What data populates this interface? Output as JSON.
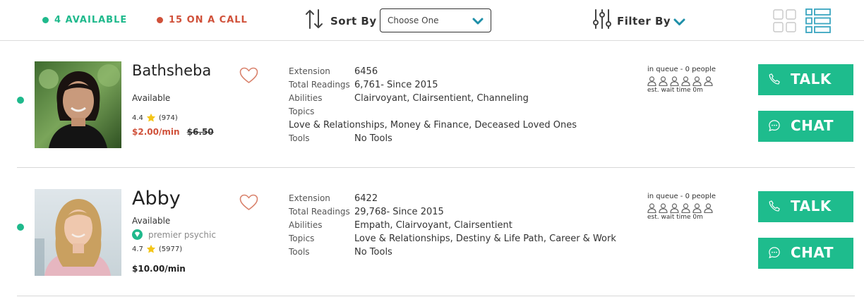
{
  "colors": {
    "accent": "#1fb98c",
    "oncall": "#d0513a",
    "button": "#1ebc8d"
  },
  "topbar": {
    "available_text": "4 AVAILABLE",
    "oncall_text": "15 ON A CALL",
    "sort_label": "Sort By",
    "sort_value": "Choose One",
    "filter_label": "Filter By",
    "icons": [
      "sort-arrows-icon",
      "chevron-down-icon",
      "filter-sliders-icon",
      "grid-view-icon",
      "list-view-icon"
    ]
  },
  "psychics": [
    {
      "name": "Bathsheba",
      "status": "Available",
      "rating": "4.4",
      "reviews": "(974)",
      "price": "$2.00/min",
      "old_price": "$6.50",
      "details": {
        "extension_label": "Extension",
        "extension": "6456",
        "readings_label": "Total Readings",
        "readings": "6,761- Since 2015",
        "abilities_label": "Abilities",
        "abilities": "Clairvoyant, Clairsentient, Channeling",
        "topics_label": "Topics",
        "topics": "Love & Relationships, Money & Finance, Deceased Loved Ones",
        "tools_label": "Tools",
        "tools": "No Tools"
      },
      "queue": {
        "title": "in queue - 0 people",
        "wait": "est. wait time 0m",
        "slots": 6
      },
      "talk_label": "TALK",
      "chat_label": "CHAT"
    },
    {
      "name": "Abby",
      "status": "Available",
      "badge": "premier psychic",
      "rating": "4.7",
      "reviews": "(5977)",
      "price": "$10.00/min",
      "details": {
        "extension_label": "Extension",
        "extension": "6422",
        "readings_label": "Total Readings",
        "readings": "29,768- Since 2015",
        "abilities_label": "Abilities",
        "abilities": "Empath, Clairvoyant, Clairsentient",
        "topics_label": "Topics",
        "topics": "Love & Relationships, Destiny & Life Path, Career & Work",
        "tools_label": "Tools",
        "tools": "No Tools"
      },
      "queue": {
        "title": "in queue - 0 people",
        "wait": "est. wait time 0m",
        "slots": 6
      },
      "talk_label": "TALK",
      "chat_label": "CHAT"
    }
  ]
}
